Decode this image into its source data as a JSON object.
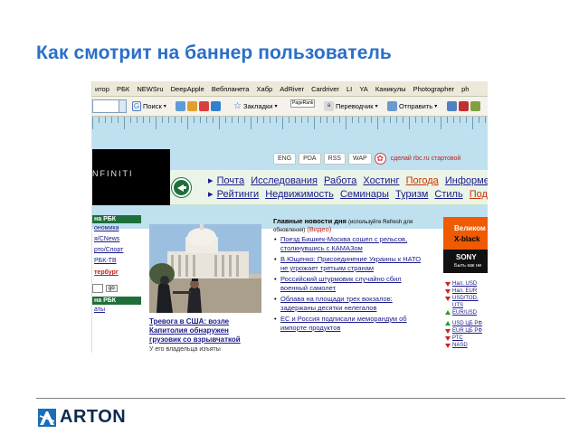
{
  "slide": {
    "title": "Как смотрит на баннер пользователь",
    "logo_text": "ARTON"
  },
  "browser": {
    "bookmarks": [
      "итор",
      "РБК",
      "NEWSru",
      "DeepApple",
      "Вебпланета",
      "Хабр",
      "AdRiver",
      "Cardriver",
      "LI",
      "YA",
      "Каникулы",
      "Photographer",
      "ph"
    ],
    "toolbar": {
      "search_label": "Поиск",
      "bookmarks_label": "Закладки",
      "pagerank_label": "PageRank",
      "translator_label": "Переводчик",
      "send_label": "Отправить"
    }
  },
  "site": {
    "banner_text": "NFINITI",
    "top_buttons": [
      "ENG",
      "PDA",
      "RSS",
      "WAP"
    ],
    "start_link": "сделай rbc.ru стартовой",
    "nav_row1": [
      "Почта",
      "Исследования",
      "Работа",
      "Хостинг",
      "Погода",
      "Информер"
    ],
    "nav_row2": [
      "Рейтинги",
      "Недвижимость",
      "Семинары",
      "Туризм",
      "Стиль",
      "Подар"
    ],
    "nav_sup": "TV",
    "left_col": {
      "head": "на РБК",
      "items": [
        "ономика",
        "я/CNews",
        "рто/Спорт",
        "РБК-ТВ"
      ],
      "red_link": "тербург",
      "go_label": "go",
      "head2": "на РБК",
      "item2": "аты"
    },
    "photo_caption": "Тревога в США: возле Капитолия обнаружен грузовик со взрывчаткой",
    "photo_subcaption": "У его владельца изъяты",
    "news": {
      "header": "Главные новости дня",
      "header_small": "(используйте Refresh для обновления)",
      "video_link": "(Видео)",
      "items": [
        "Поезд Бишкек-Москва сошел с рельсов, столкнувшись с КАМАЗом",
        "В.Ющенко: Присоединение Украины к НАТО не угрожает третьим странам",
        "Российский штурмовик случайно сбил военный самолет",
        "Облава на площади трех вокзалов: задержаны десятки нелегалов",
        "ЕС и Россия подписали меморандум об импорте продуктов"
      ]
    },
    "sony_ad": {
      "line1": "Великом",
      "line2": "X-black",
      "brand": "SONY",
      "buy": "Быть как ни"
    },
    "currency": [
      {
        "label": "Нал. USD",
        "dir": "down"
      },
      {
        "label": "Нал. EUR",
        "dir": "down"
      },
      {
        "label": "USD/TOD, UTS",
        "dir": "down"
      },
      {
        "label": "EUR/USD",
        "dir": "up"
      },
      {
        "label": "USD ЦБ РФ",
        "dir": "up"
      },
      {
        "label": "EUR ЦБ РФ",
        "dir": "down"
      },
      {
        "label": "РТС",
        "dir": "down"
      },
      {
        "label": "NASD",
        "dir": "down"
      }
    ]
  },
  "colors": {
    "title_blue": "#2a6fc8",
    "rbc_green": "#1f6f3a",
    "link_blue": "#1a1a8a",
    "accent_red": "#cc3300",
    "ruler_blue": "#bfe0ee",
    "sony_orange": "#f05a00"
  }
}
